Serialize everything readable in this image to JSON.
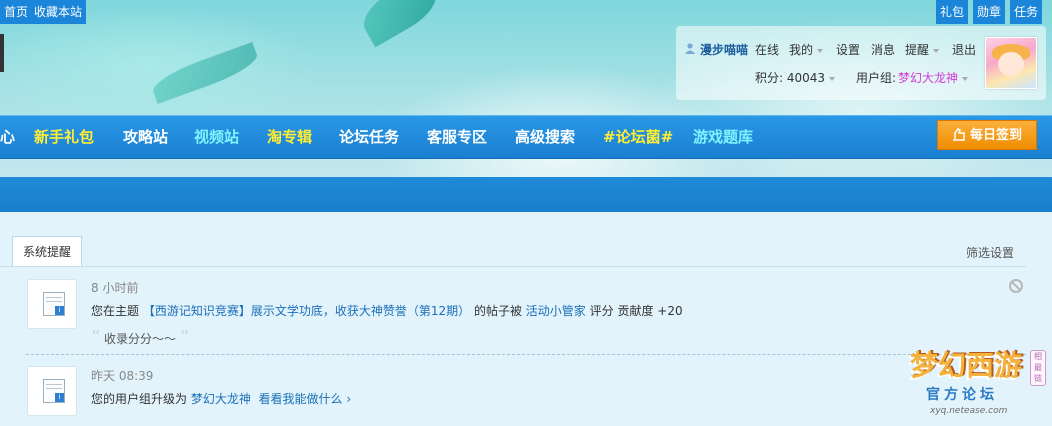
{
  "topbar": {
    "home_label": "首页",
    "favorite_label": "收藏本站",
    "gift_label": "礼包",
    "medal_label": "勋章",
    "task_label": "任务"
  },
  "profile": {
    "username": "漫步喵喵",
    "online": "在线",
    "mine": "我的",
    "settings": "设置",
    "messages": "消息",
    "reminders": "提醒",
    "logout": "退出",
    "points_label": "积分: 40043",
    "group_label": "用户组:",
    "group_value": "梦幻大龙神",
    "group_color": "#d23ad6"
  },
  "nav": {
    "partial": "心",
    "items": [
      {
        "label": "新手礼包",
        "color": "#ffee33"
      },
      {
        "label": "攻略站",
        "color": "#ffffff"
      },
      {
        "label": "视频站",
        "color": "#7ff4ff"
      },
      {
        "label": "淘专辑",
        "color": "#ffee33"
      },
      {
        "label": "论坛任务",
        "color": "#ffffff"
      },
      {
        "label": "客服专区",
        "color": "#ffffff"
      },
      {
        "label": "高级搜索",
        "color": "#ffffff"
      },
      {
        "label": "#论坛菌#",
        "color": "#ffee33"
      },
      {
        "label": "游戏题库",
        "color": "#7ff4ff"
      }
    ],
    "checkin_label": "每日签到"
  },
  "notices": {
    "tab_label": "系统提醒",
    "filter_label": "筛选设置",
    "items": [
      {
        "time": "8 小时前",
        "text_prefix": "您在主题",
        "topic_link": "【西游记知识竞赛】展示文学功底，收获大神赞誉（第12期）",
        "text_mid": "的帖子被",
        "user_link": "活动小管家",
        "text_suffix": "评分 贡献度 +20",
        "quote": "收录分分～～"
      },
      {
        "time": "昨天 08:39",
        "text_prefix": "您的用户组升级为",
        "group_link": "梦幻大龙神",
        "more_link": "看看我能做什么 ›"
      }
    ]
  },
  "logo": {
    "title": "梦幻西游",
    "subtitle": "官方论坛",
    "url": "xyq.netease.com",
    "tag": "相最链"
  }
}
